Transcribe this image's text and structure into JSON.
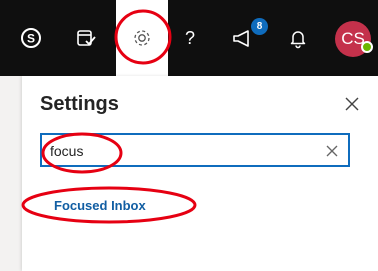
{
  "topbar": {
    "icons": [
      {
        "name": "skype-icon"
      },
      {
        "name": "my-day-icon"
      },
      {
        "name": "gear-icon"
      },
      {
        "name": "help-icon"
      },
      {
        "name": "whats-new-icon"
      },
      {
        "name": "bell-icon"
      }
    ],
    "whats_new_badge": "8",
    "avatar_initials": "CS"
  },
  "settings": {
    "title": "Settings",
    "search": {
      "value": "focus",
      "placeholder": ""
    },
    "results": [
      {
        "label": "Focused Inbox"
      }
    ]
  },
  "annotations": {
    "color": "#e60012"
  },
  "colors": {
    "topbar_bg": "#0f0f0f",
    "accent": "#0f6cbd",
    "link": "#115ea3",
    "avatar_bg": "#c4314b",
    "presence": "#6bb700"
  }
}
